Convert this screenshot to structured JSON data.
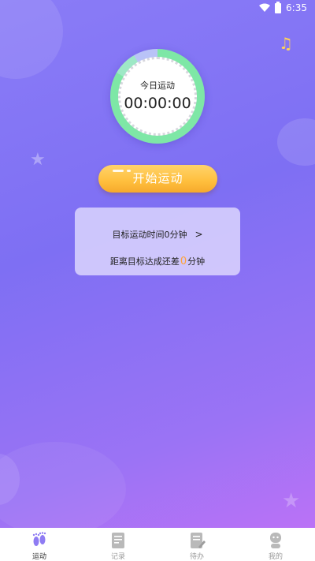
{
  "status_bar": {
    "time": "6:35"
  },
  "timer": {
    "label": "今日运动",
    "time": "00:00:00"
  },
  "actions": {
    "start_label": "开始运动"
  },
  "goal_card": {
    "goal_text": "目标运动时间0分钟",
    "chevron": ">",
    "remaining_prefix": "距离目标达成还差",
    "remaining_value": "0",
    "remaining_suffix": "分钟"
  },
  "bottom_nav": {
    "items": [
      {
        "label": "运动",
        "icon": "footprints-icon",
        "active": true
      },
      {
        "label": "记录",
        "icon": "record-doc-icon",
        "active": false
      },
      {
        "label": "待办",
        "icon": "todo-edit-icon",
        "active": false
      },
      {
        "label": "我的",
        "icon": "profile-icon",
        "active": false
      }
    ]
  },
  "colors": {
    "gradient_start": "#8a7cf7",
    "gradient_end": "#c272f6",
    "ring_progress": "#7ee7a6",
    "button": "#ffbf3d",
    "highlight_number": "#ffa23a",
    "music_icon": "#ffd25a"
  }
}
